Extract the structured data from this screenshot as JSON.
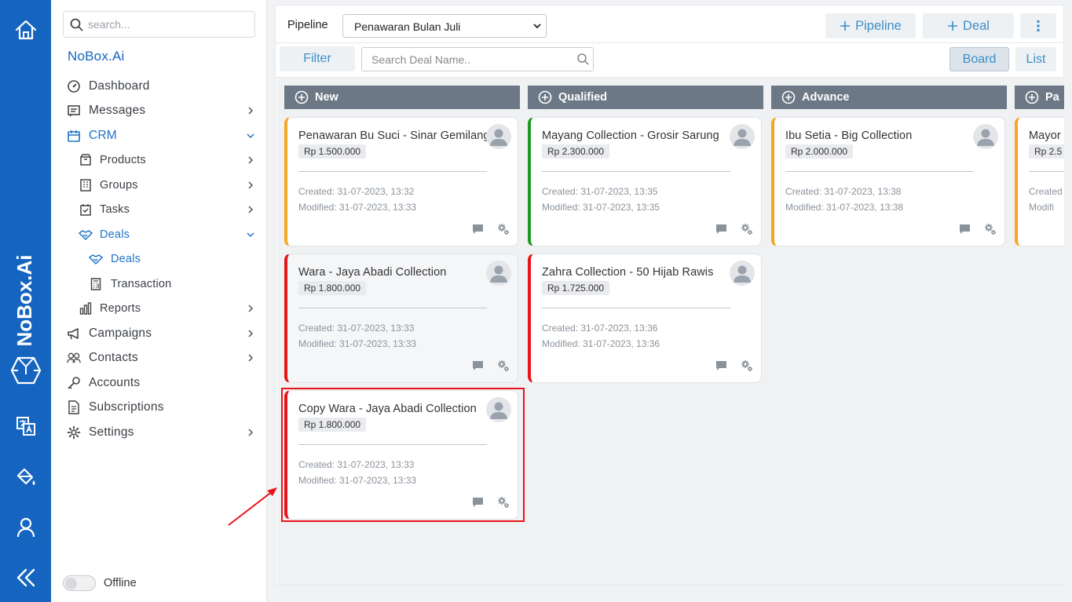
{
  "rail": {
    "brand": "NoBox.Ai",
    "icons": [
      "home-icon",
      "nobox-logo-icon",
      "translate-icon",
      "paint-bucket-icon",
      "user-icon",
      "collapse-icon"
    ]
  },
  "sidebar": {
    "search_placeholder": "search...",
    "brand": "NoBox.Ai",
    "items": [
      {
        "label": "Dashboard",
        "icon": "dashboard-icon"
      },
      {
        "label": "Messages",
        "icon": "messages-icon"
      },
      {
        "label": "CRM",
        "icon": "crm-icon"
      },
      {
        "label": "Products",
        "icon": "products-icon"
      },
      {
        "label": "Groups",
        "icon": "groups-icon"
      },
      {
        "label": "Tasks",
        "icon": "tasks-icon"
      },
      {
        "label": "Deals",
        "icon": "handshake-icon"
      },
      {
        "label": "Deals",
        "icon": "handshake-icon"
      },
      {
        "label": "Transaction",
        "icon": "calculator-icon"
      },
      {
        "label": "Reports",
        "icon": "reports-icon"
      },
      {
        "label": "Campaigns",
        "icon": "megaphone-icon"
      },
      {
        "label": "Contacts",
        "icon": "contacts-icon"
      },
      {
        "label": "Accounts",
        "icon": "key-icon"
      },
      {
        "label": "Subscriptions",
        "icon": "document-icon"
      },
      {
        "label": "Settings",
        "icon": "gear-icon"
      }
    ],
    "offline_label": "Offline"
  },
  "toolbar": {
    "pipeline_label": "Pipeline",
    "pipeline_value": "Penawaran Bulan Juli",
    "add_pipeline": "Pipeline",
    "add_deal": "Deal",
    "filter": "Filter",
    "deal_search_placeholder": "Search Deal Name..",
    "board": "Board",
    "list": "List"
  },
  "columns": [
    {
      "name": "New",
      "cards": [
        {
          "title": "Penawaran Bu Suci - Sinar Gemilang",
          "amount": "Rp 1.500.000",
          "created": "Created: 31-07-2023, 13:32",
          "modified": "Modified: 31-07-2023, 13:33"
        },
        {
          "title": "Wara - Jaya Abadi Collection",
          "amount": "Rp 1.800.000",
          "created": "Created: 31-07-2023, 13:33",
          "modified": "Modified: 31-07-2023, 13:33"
        },
        {
          "title": "Copy Wara - Jaya Abadi Collection",
          "amount": "Rp 1.800.000",
          "created": "Created: 31-07-2023, 13:33",
          "modified": "Modified: 31-07-2023, 13:33"
        }
      ]
    },
    {
      "name": "Qualified",
      "cards": [
        {
          "title": "Mayang Collection - Grosir Sarung",
          "amount": "Rp 2.300.000",
          "created": "Created: 31-07-2023, 13:35",
          "modified": "Modified: 31-07-2023, 13:35"
        },
        {
          "title": "Zahra Collection - 50 Hijab Rawis",
          "amount": "Rp 1.725.000",
          "created": "Created: 31-07-2023, 13:36",
          "modified": "Modified: 31-07-2023, 13:36"
        }
      ]
    },
    {
      "name": "Advance",
      "cards": [
        {
          "title": "Ibu Setia - Big Collection",
          "amount": "Rp 2.000.000",
          "created": "Created: 31-07-2023, 13:38",
          "modified": "Modified: 31-07-2023, 13:38"
        }
      ]
    },
    {
      "name": "Pa",
      "cards": [
        {
          "title": "Mayor",
          "amount": "Rp 2.5",
          "created": "Created",
          "modified": "Modifi"
        }
      ]
    }
  ],
  "colors": {
    "rail": "#1565c0",
    "accent": "#3d8ec8",
    "column_header": "#6c7885",
    "status_yellow": "#f5a623",
    "status_red": "#e8141a",
    "status_green": "#1e9a22"
  }
}
